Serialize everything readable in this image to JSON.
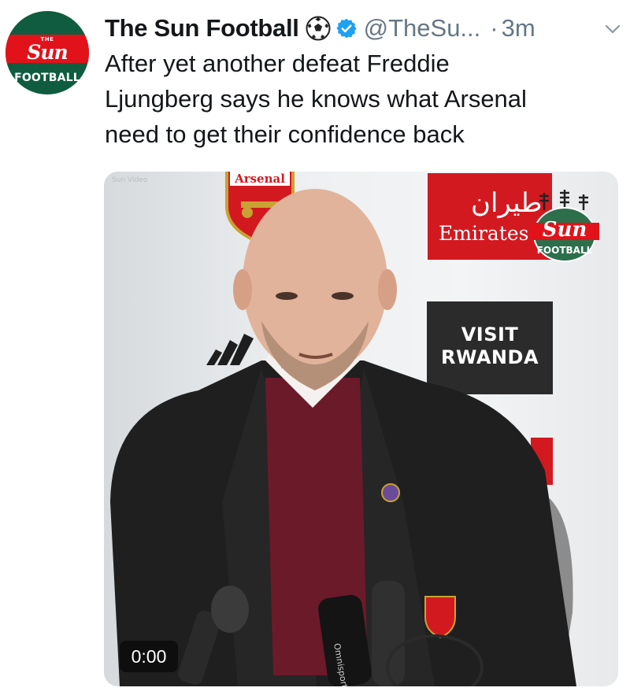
{
  "tweet": {
    "avatar_top": "THE",
    "avatar_brand": "Sun",
    "avatar_sub": "FOOTBALL",
    "display_name": "The Sun Football",
    "name_emoji": "soccer-ball-icon",
    "verified_icon": "verified-badge-icon",
    "handle": "@TheSu...",
    "separator": "·",
    "timestamp": "3m",
    "menu_icon": "chevron-down-icon",
    "text_lines": [
      "After yet another defeat Freddie",
      "Ljungberg says he knows what Arsenal",
      "need to get their confidence back"
    ]
  },
  "media": {
    "watermark": "Sun Video",
    "backdrop_crest": "Arsenal",
    "sponsor_name": "Emirates",
    "sponsor_arabic": "طيران",
    "overlay_logo_main": "Sun",
    "overlay_logo_sub": "FOOTBALL",
    "sponsor2_line1": "VISIT",
    "sponsor2_line2": "RWANDA",
    "video_timecode": "0:00"
  },
  "colors": {
    "accent_blue": "#1da1f2",
    "secondary_text": "#657786",
    "brand_red": "#e2121a",
    "brand_green": "#0f5c40"
  }
}
